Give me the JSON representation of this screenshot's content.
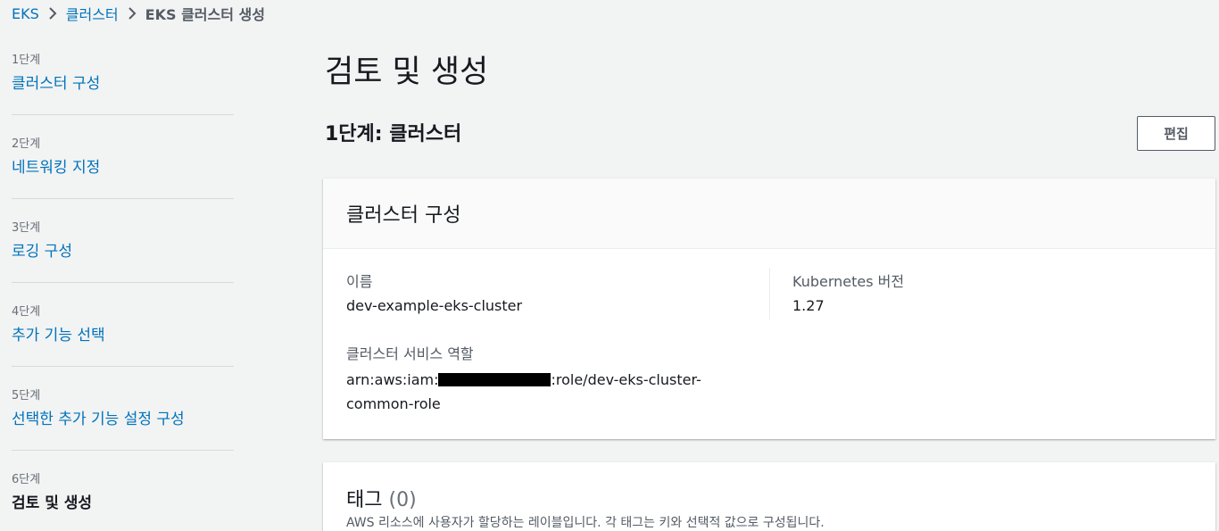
{
  "breadcrumb": {
    "items": [
      "EKS",
      "클러스터"
    ],
    "current": "EKS 클러스터 생성"
  },
  "steps": [
    {
      "num": "1단계",
      "label": "클러스터 구성"
    },
    {
      "num": "2단계",
      "label": "네트워킹 지정"
    },
    {
      "num": "3단계",
      "label": "로깅 구성"
    },
    {
      "num": "4단계",
      "label": "추가 기능 선택"
    },
    {
      "num": "5단계",
      "label": "선택한 추가 기능 설정 구성"
    },
    {
      "num": "6단계",
      "label": "검토 및 생성"
    }
  ],
  "main": {
    "title": "검토 및 생성",
    "section_title": "1단계: 클러스터",
    "edit_label": "편집"
  },
  "config_card": {
    "title": "클러스터 구성",
    "name_label": "이름",
    "name_value": "dev-example-eks-cluster",
    "k8s_label": "Kubernetes 버전",
    "k8s_value": "1.27",
    "role_label": "클러스터 서비스 역할",
    "role_prefix": "arn:aws:iam:",
    "role_suffix": ":role/dev-eks-cluster-",
    "role_line2": "common-role"
  },
  "tags_card": {
    "title": "태그",
    "count": "(0)",
    "description": "AWS 리소스에 사용자가 할당하는 레이블입니다. 각 태그는 키와 선택적 값으로 구성됩니다."
  },
  "colors": {
    "link": "#0073bb",
    "background": "#f2f3f3",
    "text": "#16191f"
  }
}
